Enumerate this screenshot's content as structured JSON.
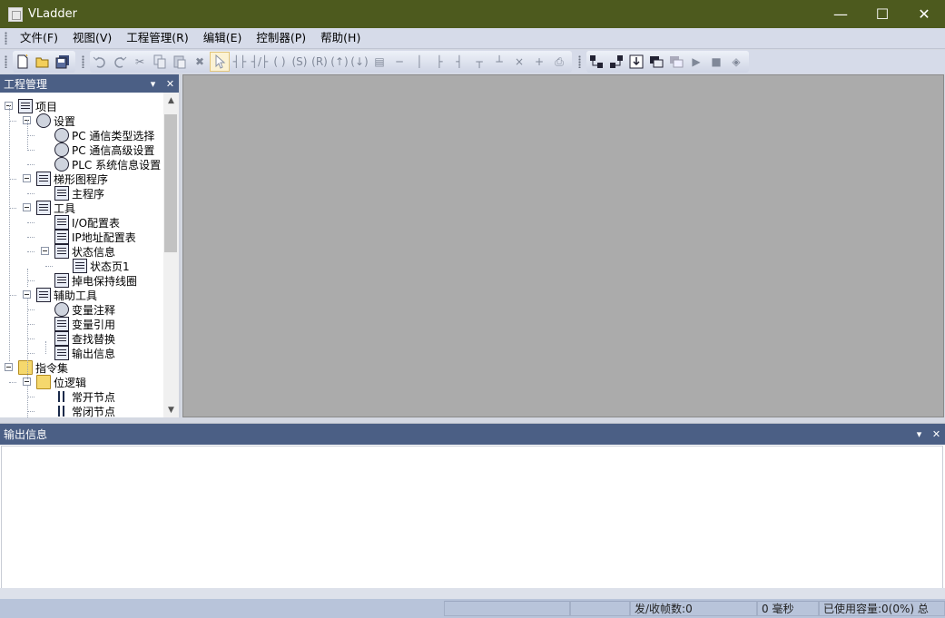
{
  "window": {
    "title": "VLadder",
    "minimize_glyph": "—",
    "maximize_glyph": "☐",
    "close_glyph": "✕"
  },
  "menubar": {
    "items": [
      {
        "label": "文件(F)"
      },
      {
        "label": "视图(V)"
      },
      {
        "label": "工程管理(R)"
      },
      {
        "label": "编辑(E)"
      },
      {
        "label": "控制器(P)"
      },
      {
        "label": "帮助(H)"
      }
    ]
  },
  "toolbar": {
    "groups": [
      [
        "new-icon",
        "open-icon",
        "save-all-icon"
      ],
      [
        "undo-icon",
        "redo-icon",
        "cut-icon",
        "copy-icon",
        "paste-icon",
        "delete-icon",
        "select-pointer-icon",
        "no-contact-icon",
        "nc-contact-icon",
        "coil-icon",
        "set-coil-icon",
        "reset-coil-icon",
        "rising-edge-coil-icon",
        "falling-edge-coil-icon",
        "function-block-icon",
        "horizontal-line-icon",
        "vertical-line-icon",
        "branch-icon",
        "unbranch-icon",
        "parallel-icon",
        "parallel-close-icon",
        "delete-row-icon",
        "insert-row-icon",
        "print-icon"
      ],
      [
        "download-icon",
        "upload-icon",
        "import-icon",
        "monitor-icon",
        "monitor-stop-icon",
        "run-icon",
        "stop-icon",
        "diagnose-icon"
      ]
    ]
  },
  "project_panel": {
    "title": "工程管理",
    "dropdown_glyph": "▾",
    "close_glyph": "✕",
    "tree": [
      {
        "label": "项目",
        "level": 0,
        "icon": "project-icon",
        "expander": true
      },
      {
        "label": "设置",
        "level": 1,
        "icon": "settings-icon",
        "expander": true
      },
      {
        "label": "PC 通信类型选择",
        "level": 2,
        "icon": "comm-type-icon"
      },
      {
        "label": "PC 通信高级设置",
        "level": 2,
        "icon": "comm-advanced-icon"
      },
      {
        "label": "PLC 系统信息设置",
        "level": 2,
        "icon": "plc-info-icon"
      },
      {
        "label": "梯形图程序",
        "level": 1,
        "icon": "ladder-program-icon",
        "expander": true
      },
      {
        "label": "主程序",
        "level": 2,
        "icon": "main-program-icon"
      },
      {
        "label": "工具",
        "level": 1,
        "icon": "tools-icon",
        "expander": true
      },
      {
        "label": "I/O配置表",
        "level": 2,
        "icon": "io-config-icon"
      },
      {
        "label": "IP地址配置表",
        "level": 2,
        "icon": "ip-config-icon"
      },
      {
        "label": "状态信息",
        "level": 2,
        "icon": "status-info-icon",
        "expander": true
      },
      {
        "label": "状态页1",
        "level": 3,
        "icon": "status-page-icon"
      },
      {
        "label": "掉电保持线圈",
        "level": 2,
        "icon": "retentive-coil-icon"
      },
      {
        "label": "辅助工具",
        "level": 1,
        "icon": "aux-tools-icon",
        "expander": true
      },
      {
        "label": "变量注释",
        "level": 2,
        "icon": "variable-comment-icon"
      },
      {
        "label": "变量引用",
        "level": 2,
        "icon": "variable-ref-icon"
      },
      {
        "label": "查找替换",
        "level": 2,
        "icon": "find-replace-icon"
      },
      {
        "label": "输出信息",
        "level": 2,
        "icon": "output-info-icon"
      },
      {
        "label": "指令集",
        "level": 0,
        "icon": "folder-icon",
        "expander": true
      },
      {
        "label": "位逻辑",
        "level": 1,
        "icon": "bit-logic-icon",
        "expander": true
      },
      {
        "label": "常开节点",
        "level": 2,
        "icon": "no-contact-icon"
      },
      {
        "label": "常闭节点",
        "level": 2,
        "icon": "nc-contact-icon"
      }
    ]
  },
  "output_panel": {
    "title": "输出信息",
    "dropdown_glyph": "▾",
    "close_glyph": "✕"
  },
  "statusbar": {
    "cells": [
      "",
      "",
      "发/收帧数:0",
      "0 毫秒",
      "已使用容量:0(0%) 总"
    ]
  }
}
